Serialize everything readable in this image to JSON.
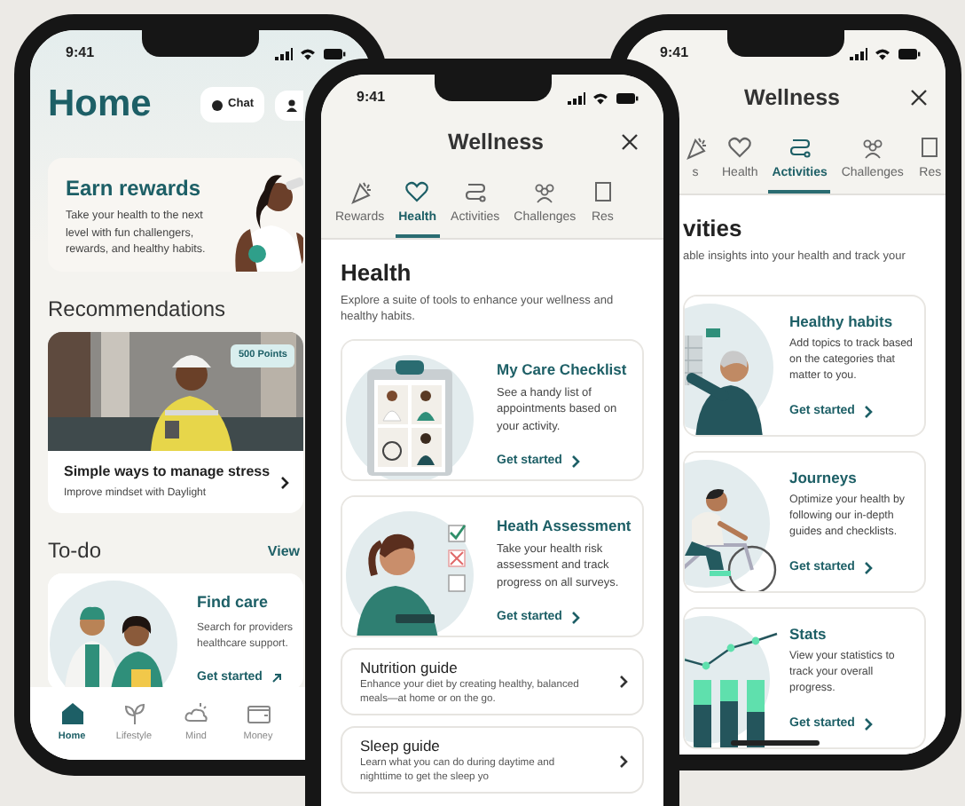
{
  "home_screen": {
    "time": "9:41",
    "title": "Home",
    "chat_button": "Chat",
    "banner": {
      "title": "Earn rewards",
      "text": "Take your health to the next level with fun challengers, rewards, and healthy habits."
    },
    "recommendations": {
      "heading": "Recommendations",
      "badge": "500 Points",
      "title": "Simple ways to manage stress",
      "subtitle": "Improve mindset with Daylight"
    },
    "todo": {
      "heading": "To-do",
      "link": "View",
      "card": {
        "title": "Find care",
        "text": "Search for providers healthcare support.",
        "action": "Get started"
      }
    },
    "nav": [
      {
        "label": "Home",
        "selected": true
      },
      {
        "label": "Lifestyle",
        "selected": false
      },
      {
        "label": "Mind",
        "selected": false
      },
      {
        "label": "Money",
        "selected": false
      }
    ]
  },
  "wellness_screens": [
    {
      "time": "9:41",
      "title": "Wellness",
      "tabs": [
        {
          "label": "Rewards",
          "selected": false
        },
        {
          "label": "Health",
          "selected": true
        },
        {
          "label": "Activities",
          "selected": false
        },
        {
          "label": "Challenges",
          "selected": false
        },
        {
          "label": "Res",
          "selected": false
        }
      ],
      "heading": "Health",
      "intro": "Explore a suite of tools to enhance your wellness and healthy habits.",
      "cards": [
        {
          "kind": "feature",
          "title": "My Care Checklist",
          "text": "See a handy list of appointments based on your activity.",
          "action": "Get started"
        },
        {
          "kind": "feature",
          "title": "Heath Assessment",
          "text": "Take your health risk assessment and track progress on all surveys.",
          "action": "Get started"
        },
        {
          "kind": "guide",
          "title": "Nutrition guide",
          "text": "Enhance your diet by creating healthy, balanced meals—at home or on the go."
        },
        {
          "kind": "guide",
          "title": "Sleep guide",
          "text": "Learn what you can do during daytime and nighttime to get the sleep yo"
        }
      ]
    },
    {
      "time": "9:41",
      "title": "Wellness",
      "tabs": [
        {
          "label": "s",
          "selected": false
        },
        {
          "label": "Health",
          "selected": false
        },
        {
          "label": "Activities",
          "selected": true
        },
        {
          "label": "Challenges",
          "selected": false
        },
        {
          "label": "Res",
          "selected": false
        }
      ],
      "heading": "vities",
      "intro": "able insights into your health and track your",
      "cards": [
        {
          "kind": "feature",
          "title": "Healthy habits",
          "text": "Add topics to track based on the categories that matter to you.",
          "action": "Get started"
        },
        {
          "kind": "feature",
          "title": "Journeys",
          "text": "Optimize your health by following our in-depth guides and checklists.",
          "action": "Get started"
        },
        {
          "kind": "feature",
          "title": "Stats",
          "text": "View your statistics to track your overall progress.",
          "action": "Get started"
        }
      ]
    }
  ]
}
